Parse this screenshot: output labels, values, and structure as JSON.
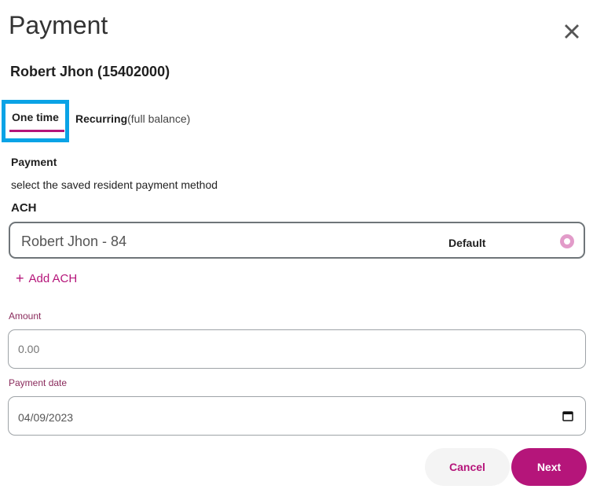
{
  "modal": {
    "title": "Payment",
    "resident": "Robert Jhon (15402000)"
  },
  "tabs": [
    {
      "label": "One time",
      "selected": true
    },
    {
      "label": "Recurring",
      "note": "(full balance)",
      "selected": false
    }
  ],
  "payment_section": {
    "label": "Payment",
    "instruction": "select the saved resident payment method",
    "method_type": "ACH"
  },
  "ach_method": {
    "name": "Robert Jhon - 84",
    "default_label": "Default",
    "selected": true
  },
  "add_ach": {
    "label": "Add ACH"
  },
  "amount": {
    "label": "Amount",
    "placeholder": "0.00"
  },
  "payment_date": {
    "label": "Payment date",
    "value": "04/09/2023"
  },
  "actions": {
    "cancel_label": "Cancel",
    "next_label": "Next"
  },
  "colors": {
    "accent": "#b5157a",
    "tab_highlight": "#0aa3e6",
    "field_label": "#8a2b5c",
    "radio": "#e29bc9"
  },
  "icons": {
    "close": "close-icon",
    "plus": "plus-icon",
    "calendar": "calendar-icon"
  }
}
